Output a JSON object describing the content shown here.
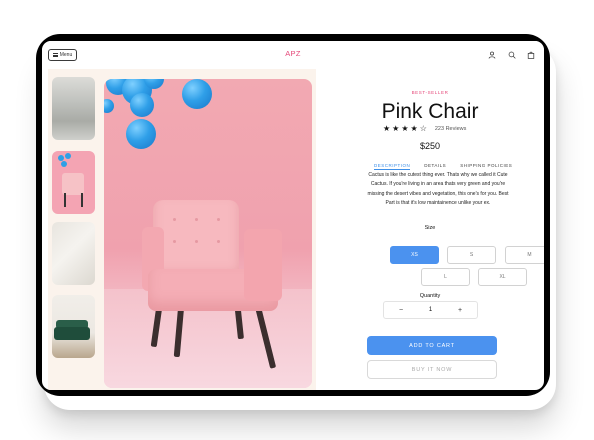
{
  "colors": {
    "accent": "#4b92ef",
    "brand": "#e5497a",
    "device_frame": "#000000",
    "gallery_bg": "#fbf3ec"
  },
  "header": {
    "menu_label": "Menu",
    "logo": "APZ",
    "icons": [
      "user-icon",
      "search-icon",
      "bag-icon"
    ]
  },
  "gallery": {
    "thumbnails": [
      "office-thumbnail",
      "pink-chair-thumbnail",
      "white-fabric-thumbnail",
      "green-sofa-thumbnail"
    ]
  },
  "product": {
    "badge": "BEST-SELLER",
    "name": "Pink Chair",
    "rating": 4,
    "rating_max": 5,
    "reviews": "223 Reviews",
    "price": "$250"
  },
  "tabs": [
    {
      "label": "DESCRIPTION",
      "active": true
    },
    {
      "label": "DETAILS",
      "active": false
    },
    {
      "label": "SHIPPING POLICIES",
      "active": false
    }
  ],
  "description": "Cactus is like the cutest thing ever. Thats why we called it Cute Cactus. If you're living in an area thats very green and you're missing the desert vibes and vegetation, this one's for you. Best Part is that it's low maintainence unlike your ex.",
  "size": {
    "label": "Size",
    "options": [
      "XS",
      "S",
      "M",
      "L",
      "XL"
    ],
    "selected": "XS"
  },
  "quantity": {
    "label": "Quantity",
    "value": "1",
    "decrement": "−",
    "increment": "+"
  },
  "actions": {
    "add_to_cart": "ADD TO CART",
    "buy_now": "BUY IT NOW"
  }
}
